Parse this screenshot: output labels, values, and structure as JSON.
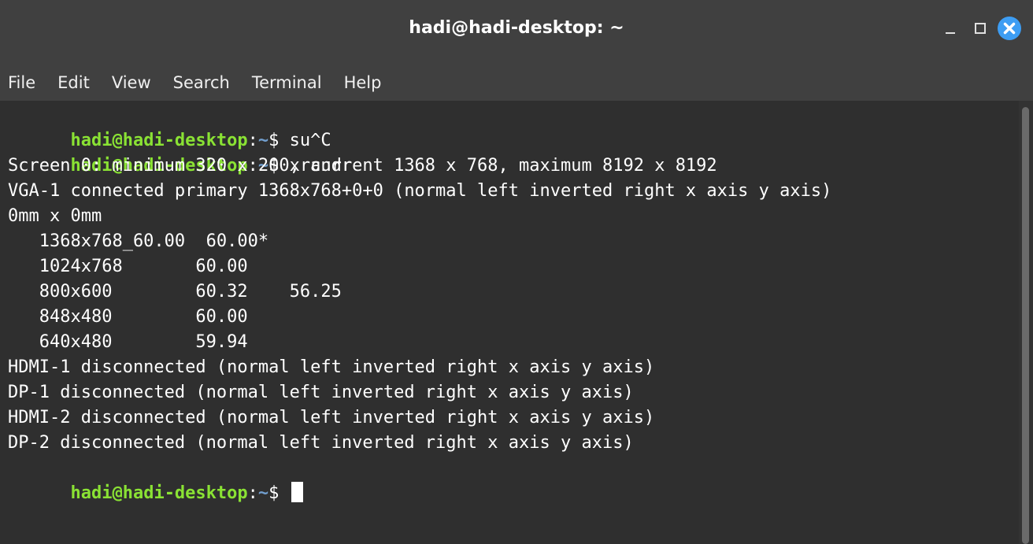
{
  "window": {
    "title": "hadi@hadi-desktop: ~",
    "controls": [
      "minimize-icon",
      "maximize-icon",
      "close-icon"
    ],
    "close_color": "#3d9df3"
  },
  "menubar": {
    "items": [
      "File",
      "Edit",
      "View",
      "Search",
      "Terminal",
      "Help"
    ]
  },
  "terminal": {
    "prompt_user": "hadi@hadi-desktop",
    "prompt_sep": ":",
    "prompt_path": "~",
    "prompt_symbol": "$ ",
    "commands": [
      "su^C",
      "xrandr"
    ],
    "output": [
      "Screen 0: minimum 320 x 200, current 1368 x 768, maximum 8192 x 8192",
      "VGA-1 connected primary 1368x768+0+0 (normal left inverted right x axis y axis)",
      "0mm x 0mm",
      "   1368x768_60.00  60.00*",
      "   1024x768       60.00",
      "   800x600        60.32    56.25",
      "   848x480        60.00",
      "   640x480        59.94",
      "HDMI-1 disconnected (normal left inverted right x axis y axis)",
      "DP-1 disconnected (normal left inverted right x axis y axis)",
      "HDMI-2 disconnected (normal left inverted right x axis y axis)",
      "DP-2 disconnected (normal left inverted right x axis y axis)"
    ],
    "colors": {
      "background": "#2f2f2f",
      "text": "#ffffff",
      "prompt_user": "#8ae234",
      "prompt_path": "#729fcf"
    }
  }
}
